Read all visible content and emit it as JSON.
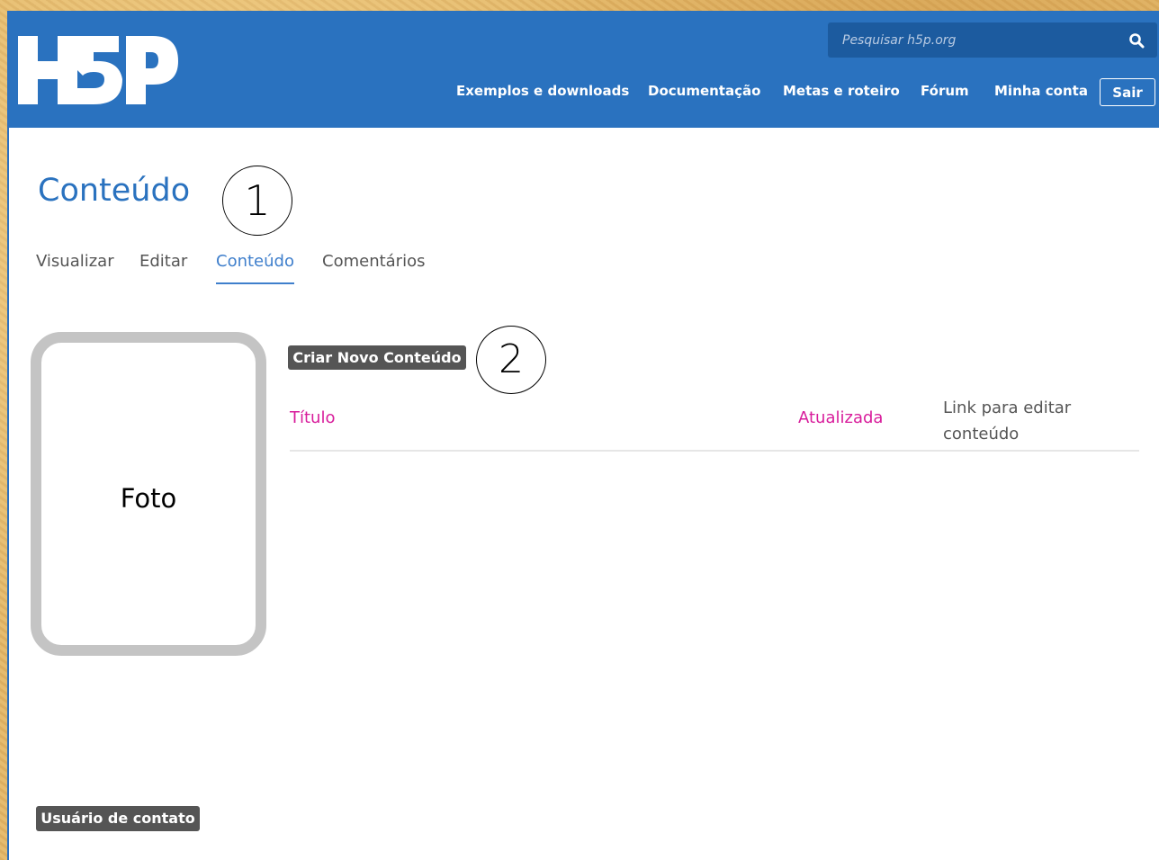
{
  "header": {
    "logo_text": "H5P",
    "search": {
      "placeholder": "Pesquisar h5p.org",
      "icon": "search-icon"
    },
    "nav": [
      "Exemplos e downloads",
      "Documentação",
      "Metas e roteiro",
      "Fórum",
      "Minha conta"
    ],
    "logout_label": "Sair",
    "bg_color": "#2a72bf"
  },
  "page": {
    "title": "Conteúdo",
    "tabs": [
      "Visualizar",
      "Editar",
      "Conteúdo",
      "Comentários"
    ],
    "active_tab": "Conteúdo"
  },
  "annotations": [
    "1",
    "2"
  ],
  "photo_placeholder": "Foto",
  "create_button": "Criar Novo Conteúdo",
  "table": {
    "headers": [
      "Título",
      "Atualizada",
      "Link para editar",
      "conteúdo"
    ]
  },
  "contact_button": "Usuário de contato",
  "colors": {
    "accent": "#2a72bf",
    "pink": "#d81c9b",
    "button": "#555555"
  }
}
